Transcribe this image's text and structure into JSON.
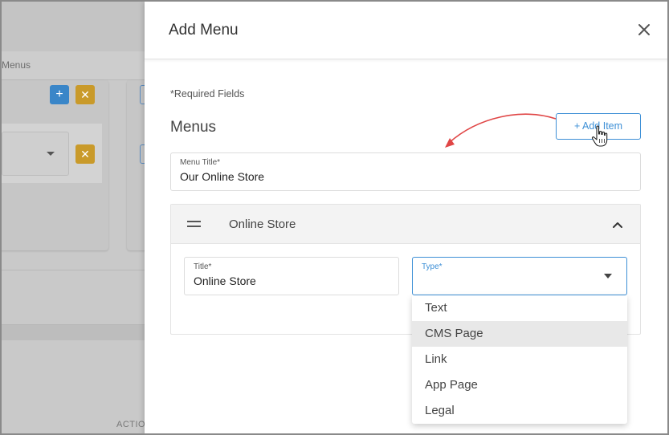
{
  "background": {
    "breadcrumb": "Menus",
    "footer_text": "ACTIO",
    "add_glyph": "+",
    "remove_glyph": "✕"
  },
  "drawer": {
    "title": "Add Menu",
    "required_note": "*Required Fields",
    "section_title": "Menus",
    "add_item_label": "+ Add Item",
    "menu_title_field": {
      "label": "Menu Title*",
      "value": "Our Online Store"
    },
    "panel": {
      "title": "Online Store",
      "title_field": {
        "label": "Title*",
        "value": "Online Store"
      },
      "type_field": {
        "label": "Type*",
        "value": ""
      }
    },
    "type_options": [
      "Text",
      "CMS Page",
      "Link",
      "App Page",
      "Legal"
    ],
    "highlighted_option": "CMS Page"
  },
  "colors": {
    "accent": "#3d8fd6",
    "annotation_arrow": "#e04646",
    "bg_add_button": "#3a86c8",
    "bg_remove_button": "#c99a2a"
  }
}
